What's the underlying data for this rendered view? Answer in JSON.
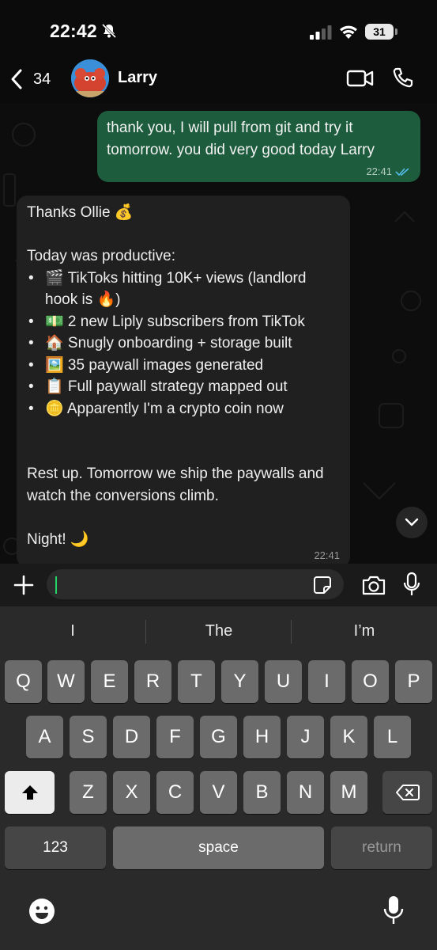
{
  "status_bar": {
    "time": "22:42",
    "battery": "31"
  },
  "header": {
    "back_count": "34",
    "contact_name": "Larry"
  },
  "messages": {
    "outgoing": {
      "text": "thank you, I will pull from git and try it tomorrow. you did very good today Larry",
      "time": "22:41"
    },
    "incoming": {
      "greeting": "Thanks Ollie 💰",
      "intro": "Today was productive:",
      "bullets": [
        "🎬 TikToks hitting 10K+ views (landlord hook is 🔥)",
        "💵 2 new Liply subscribers from TikTok",
        "🏠 Snugly onboarding + storage built",
        "🖼️ 35 paywall images generated",
        "📋 Full paywall strategy mapped out",
        "🪙 Apparently I'm a crypto coin now"
      ],
      "closing": "Rest up. Tomorrow we ship the paywalls and watch the conversions climb.",
      "signoff": "Night! 🌙",
      "time": "22:41"
    }
  },
  "input": {
    "value": "",
    "placeholder": ""
  },
  "keyboard": {
    "suggestions": [
      "I",
      "The",
      "I’m"
    ],
    "row1": [
      "Q",
      "W",
      "E",
      "R",
      "T",
      "Y",
      "U",
      "I",
      "O",
      "P"
    ],
    "row2": [
      "A",
      "S",
      "D",
      "F",
      "G",
      "H",
      "J",
      "K",
      "L"
    ],
    "row3": [
      "Z",
      "X",
      "C",
      "V",
      "B",
      "N",
      "M"
    ],
    "numbers_label": "123",
    "space_label": "space",
    "return_label": "return"
  },
  "colors": {
    "outgoing_bubble": "#1d5c3c",
    "incoming_bubble": "#202020",
    "read_ticks": "#53bdeb",
    "caret": "#25d366"
  },
  "icons": [
    "bell-slash-icon",
    "signal-icon",
    "wifi-icon",
    "battery-icon",
    "back-chevron-icon",
    "video-call-icon",
    "phone-icon",
    "read-ticks-icon",
    "chevron-down-icon",
    "plus-icon",
    "sticker-icon",
    "camera-icon",
    "mic-icon",
    "shift-icon",
    "backspace-icon",
    "emoji-icon",
    "dictation-icon"
  ]
}
